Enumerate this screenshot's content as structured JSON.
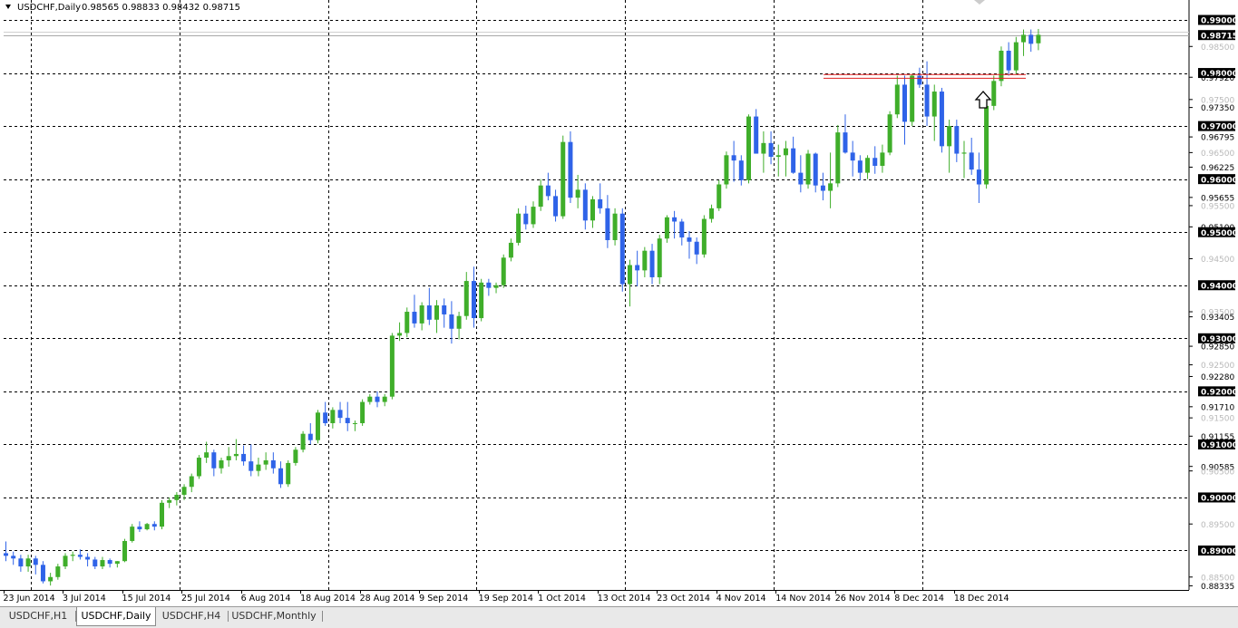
{
  "header": {
    "symbol_label": "USDCHF,Daily",
    "ohlc_text": "0.98565 0.98833 0.98432 0.98715"
  },
  "tabs": [
    {
      "label": "USDCHF,H1",
      "active": false
    },
    {
      "label": "USDCHF,Daily",
      "active": true
    },
    {
      "label": "USDCHF,H4",
      "active": false
    },
    {
      "label": "USDCHF,Monthly",
      "active": false
    }
  ],
  "colors": {
    "bull": "#3fae2a",
    "bear": "#2f63e8",
    "grid": "#000000",
    "resistance": "#e02020",
    "current_price_box": "#000000",
    "current_price_line": "#a8a8a8"
  },
  "chart_data": {
    "type": "candlestick",
    "title": "USDCHF,Daily",
    "ylim": [
      0.88335,
      0.90385
    ],
    "y_axis_labels": [
      {
        "value": 0.99,
        "label": "0.99000",
        "boxed": true
      },
      {
        "value": 0.98715,
        "label": "0.98715",
        "boxed": true,
        "current": true
      },
      {
        "value": 0.985,
        "label": "0.98500",
        "boxed": false,
        "faint": true
      },
      {
        "value": 0.98,
        "label": "0.98000",
        "boxed": true
      },
      {
        "value": 0.9792,
        "label": "0.97920",
        "boxed": false
      },
      {
        "value": 0.975,
        "label": "0.97500",
        "boxed": false,
        "faint": true
      },
      {
        "value": 0.9735,
        "label": "0.97350",
        "boxed": false
      },
      {
        "value": 0.97,
        "label": "0.97000",
        "boxed": true
      },
      {
        "value": 0.96795,
        "label": "0.96795",
        "boxed": false
      },
      {
        "value": 0.965,
        "label": "0.96500",
        "boxed": false,
        "faint": true
      },
      {
        "value": 0.96225,
        "label": "0.96225",
        "boxed": false
      },
      {
        "value": 0.96,
        "label": "0.96000",
        "boxed": true
      },
      {
        "value": 0.95655,
        "label": "0.95655",
        "boxed": false
      },
      {
        "value": 0.955,
        "label": "0.95500",
        "boxed": false,
        "faint": true
      },
      {
        "value": 0.951,
        "label": "0.95100",
        "boxed": false
      },
      {
        "value": 0.95,
        "label": "0.95000",
        "boxed": true
      },
      {
        "value": 0.945,
        "label": "0.94500",
        "boxed": false,
        "faint": true
      },
      {
        "value": 0.94,
        "label": "0.94000",
        "boxed": true
      },
      {
        "value": 0.935,
        "label": "0.93500",
        "boxed": false,
        "faint": true
      },
      {
        "value": 0.93405,
        "label": "0.93405",
        "boxed": false
      },
      {
        "value": 0.93,
        "label": "0.93000",
        "boxed": true
      },
      {
        "value": 0.9285,
        "label": "0.92850",
        "boxed": false
      },
      {
        "value": 0.925,
        "label": "0.92500",
        "boxed": false,
        "faint": true
      },
      {
        "value": 0.9228,
        "label": "0.92280",
        "boxed": false
      },
      {
        "value": 0.92,
        "label": "0.92000",
        "boxed": true
      },
      {
        "value": 0.9171,
        "label": "0.91710",
        "boxed": false
      },
      {
        "value": 0.915,
        "label": "0.91500",
        "boxed": false,
        "faint": true
      },
      {
        "value": 0.91155,
        "label": "0.91155",
        "boxed": false
      },
      {
        "value": 0.91,
        "label": "0.91000",
        "boxed": true
      },
      {
        "value": 0.90585,
        "label": "0.90585",
        "boxed": false
      },
      {
        "value": 0.905,
        "label": "0.90500",
        "boxed": false,
        "faint": true
      },
      {
        "value": 0.9,
        "label": "0.90000",
        "boxed": true
      },
      {
        "value": 0.895,
        "label": "0.89500",
        "boxed": false,
        "faint": true
      },
      {
        "value": 0.89,
        "label": "0.89000",
        "boxed": true
      },
      {
        "value": 0.885,
        "label": "0.88500",
        "boxed": false,
        "faint": true
      },
      {
        "value": 0.88335,
        "label": "0.88335",
        "boxed": false
      }
    ],
    "x_axis_labels": [
      {
        "bar": 0,
        "label": "23 Jun 2014"
      },
      {
        "bar": 8,
        "label": "3 Jul 2014"
      },
      {
        "bar": 16,
        "label": "15 Jul 2014"
      },
      {
        "bar": 24,
        "label": "25 Jul 2014"
      },
      {
        "bar": 32,
        "label": "6 Aug 2014"
      },
      {
        "bar": 40,
        "label": "18 Aug 2014"
      },
      {
        "bar": 48,
        "label": "28 Aug 2014"
      },
      {
        "bar": 56,
        "label": "9 Sep 2014"
      },
      {
        "bar": 64,
        "label": "19 Sep 2014"
      },
      {
        "bar": 72,
        "label": "1 Oct 2014"
      },
      {
        "bar": 80,
        "label": "13 Oct 2014"
      },
      {
        "bar": 88,
        "label": "23 Oct 2014"
      },
      {
        "bar": 96,
        "label": "4 Nov 2014"
      },
      {
        "bar": 104,
        "label": "14 Nov 2014"
      },
      {
        "bar": 112,
        "label": "26 Nov 2014"
      },
      {
        "bar": 120,
        "label": "8 Dec 2014"
      },
      {
        "bar": 128,
        "label": "18 Dec 2014"
      }
    ],
    "horizontal_grid": [
      0.99,
      0.98,
      0.97,
      0.96,
      0.95,
      0.94,
      0.93,
      0.92,
      0.91,
      0.9,
      0.89
    ],
    "current_price": 0.98715,
    "resistance_lines": [
      0.9797,
      0.979
    ],
    "arrow_annotation": "up-arrow",
    "candles": [
      [
        0.8895,
        0.8917,
        0.888,
        0.889
      ],
      [
        0.889,
        0.8898,
        0.8873,
        0.8885
      ],
      [
        0.8885,
        0.8892,
        0.886,
        0.887
      ],
      [
        0.887,
        0.8892,
        0.886,
        0.8885
      ],
      [
        0.8885,
        0.889,
        0.8855,
        0.8873
      ],
      [
        0.8873,
        0.888,
        0.8838,
        0.8842
      ],
      [
        0.8842,
        0.8858,
        0.8834,
        0.885
      ],
      [
        0.885,
        0.8875,
        0.8845,
        0.887
      ],
      [
        0.887,
        0.8895,
        0.8865,
        0.889
      ],
      [
        0.889,
        0.8898,
        0.888,
        0.8892
      ],
      [
        0.8892,
        0.8902,
        0.8883,
        0.8888
      ],
      [
        0.8888,
        0.8895,
        0.887,
        0.8883
      ],
      [
        0.8883,
        0.8888,
        0.8865,
        0.887
      ],
      [
        0.887,
        0.8888,
        0.8865,
        0.8882
      ],
      [
        0.8882,
        0.8885,
        0.8868,
        0.8875
      ],
      [
        0.8875,
        0.888,
        0.8868,
        0.888
      ],
      [
        0.888,
        0.8922,
        0.8878,
        0.8918
      ],
      [
        0.8918,
        0.895,
        0.8915,
        0.8945
      ],
      [
        0.8945,
        0.8955,
        0.8935,
        0.894
      ],
      [
        0.894,
        0.8952,
        0.8938,
        0.895
      ],
      [
        0.895,
        0.8955,
        0.8938,
        0.8945
      ],
      [
        0.8945,
        0.8995,
        0.894,
        0.899
      ],
      [
        0.899,
        0.9,
        0.898,
        0.8995
      ],
      [
        0.8995,
        0.901,
        0.8985,
        0.9005
      ],
      [
        0.9005,
        0.9025,
        0.8995,
        0.902
      ],
      [
        0.902,
        0.9045,
        0.901,
        0.904
      ],
      [
        0.904,
        0.908,
        0.9035,
        0.9075
      ],
      [
        0.9075,
        0.9105,
        0.9065,
        0.9085
      ],
      [
        0.9085,
        0.909,
        0.904,
        0.9055
      ],
      [
        0.9055,
        0.9075,
        0.9045,
        0.907
      ],
      [
        0.907,
        0.9095,
        0.9058,
        0.9078
      ],
      [
        0.9078,
        0.911,
        0.907,
        0.9082
      ],
      [
        0.9082,
        0.9098,
        0.906,
        0.9068
      ],
      [
        0.9068,
        0.91,
        0.904,
        0.905
      ],
      [
        0.905,
        0.9075,
        0.904,
        0.9062
      ],
      [
        0.9062,
        0.9085,
        0.9052,
        0.907
      ],
      [
        0.907,
        0.9085,
        0.9045,
        0.9055
      ],
      [
        0.9055,
        0.9068,
        0.9018,
        0.9025
      ],
      [
        0.9025,
        0.907,
        0.902,
        0.9065
      ],
      [
        0.9065,
        0.9095,
        0.906,
        0.909
      ],
      [
        0.909,
        0.9125,
        0.9085,
        0.912
      ],
      [
        0.912,
        0.914,
        0.91,
        0.9108
      ],
      [
        0.9108,
        0.9165,
        0.9102,
        0.916
      ],
      [
        0.916,
        0.918,
        0.9135,
        0.914
      ],
      [
        0.914,
        0.917,
        0.913,
        0.9165
      ],
      [
        0.9165,
        0.918,
        0.914,
        0.915
      ],
      [
        0.915,
        0.918,
        0.9125,
        0.914
      ],
      [
        0.914,
        0.9145,
        0.9125,
        0.914
      ],
      [
        0.914,
        0.9185,
        0.9135,
        0.918
      ],
      [
        0.918,
        0.9195,
        0.9175,
        0.919
      ],
      [
        0.919,
        0.92,
        0.917,
        0.918
      ],
      [
        0.918,
        0.9195,
        0.9172,
        0.919
      ],
      [
        0.919,
        0.931,
        0.9185,
        0.9305
      ],
      [
        0.9305,
        0.933,
        0.9295,
        0.931
      ],
      [
        0.931,
        0.9358,
        0.9302,
        0.935
      ],
      [
        0.935,
        0.9382,
        0.932,
        0.9328
      ],
      [
        0.9328,
        0.9368,
        0.9315,
        0.9362
      ],
      [
        0.9362,
        0.9395,
        0.9325,
        0.9335
      ],
      [
        0.9335,
        0.9372,
        0.931,
        0.9362
      ],
      [
        0.9362,
        0.9375,
        0.932,
        0.9345
      ],
      [
        0.9345,
        0.937,
        0.929,
        0.9318
      ],
      [
        0.9318,
        0.935,
        0.9298,
        0.9342
      ],
      [
        0.9342,
        0.9425,
        0.9335,
        0.9408
      ],
      [
        0.9408,
        0.9435,
        0.932,
        0.9338
      ],
      [
        0.9338,
        0.9412,
        0.9332,
        0.9405
      ],
      [
        0.9405,
        0.9412,
        0.938,
        0.9395
      ],
      [
        0.9395,
        0.9405,
        0.9385,
        0.94
      ],
      [
        0.94,
        0.9458,
        0.9395,
        0.9452
      ],
      [
        0.9452,
        0.9488,
        0.9445,
        0.948
      ],
      [
        0.948,
        0.9545,
        0.9475,
        0.9535
      ],
      [
        0.9535,
        0.955,
        0.9505,
        0.9515
      ],
      [
        0.9515,
        0.9558,
        0.9508,
        0.9548
      ],
      [
        0.9548,
        0.96,
        0.954,
        0.9588
      ],
      [
        0.9588,
        0.9612,
        0.956,
        0.9568
      ],
      [
        0.9568,
        0.958,
        0.952,
        0.953
      ],
      [
        0.953,
        0.9682,
        0.9525,
        0.967
      ],
      [
        0.967,
        0.969,
        0.9555,
        0.9565
      ],
      [
        0.9565,
        0.9608,
        0.9545,
        0.958
      ],
      [
        0.958,
        0.9592,
        0.9505,
        0.9522
      ],
      [
        0.9522,
        0.9568,
        0.9508,
        0.9562
      ],
      [
        0.9562,
        0.9592,
        0.9535,
        0.9545
      ],
      [
        0.9545,
        0.957,
        0.947,
        0.9485
      ],
      [
        0.9485,
        0.9545,
        0.9475,
        0.9535
      ],
      [
        0.9535,
        0.9545,
        0.9388,
        0.9402
      ],
      [
        0.9402,
        0.9448,
        0.936,
        0.9438
      ],
      [
        0.9438,
        0.9465,
        0.9398,
        0.9428
      ],
      [
        0.9428,
        0.9472,
        0.9415,
        0.9465
      ],
      [
        0.9465,
        0.9478,
        0.9402,
        0.9415
      ],
      [
        0.9415,
        0.9495,
        0.9402,
        0.9488
      ],
      [
        0.9488,
        0.9532,
        0.948,
        0.9528
      ],
      [
        0.9528,
        0.954,
        0.9488,
        0.952
      ],
      [
        0.952,
        0.9525,
        0.9475,
        0.949
      ],
      [
        0.949,
        0.9502,
        0.945,
        0.9482
      ],
      [
        0.9482,
        0.949,
        0.944,
        0.9458
      ],
      [
        0.9458,
        0.9532,
        0.9452,
        0.9525
      ],
      [
        0.9525,
        0.9552,
        0.9518,
        0.9545
      ],
      [
        0.9545,
        0.9598,
        0.954,
        0.959
      ],
      [
        0.959,
        0.9652,
        0.9582,
        0.9645
      ],
      [
        0.9645,
        0.9672,
        0.9595,
        0.9635
      ],
      [
        0.9635,
        0.9645,
        0.9588,
        0.9598
      ],
      [
        0.9598,
        0.9722,
        0.9592,
        0.9718
      ],
      [
        0.9718,
        0.9732,
        0.9648,
        0.9648
      ],
      [
        0.9648,
        0.969,
        0.9612,
        0.9668
      ],
      [
        0.9668,
        0.969,
        0.9628,
        0.9642
      ],
      [
        0.9642,
        0.9665,
        0.9605,
        0.9645
      ],
      [
        0.9645,
        0.9672,
        0.9605,
        0.9658
      ],
      [
        0.9658,
        0.968,
        0.961,
        0.9612
      ],
      [
        0.9612,
        0.9645,
        0.9575,
        0.959
      ],
      [
        0.959,
        0.9655,
        0.9582,
        0.9648
      ],
      [
        0.9648,
        0.965,
        0.9575,
        0.9588
      ],
      [
        0.9588,
        0.9612,
        0.956,
        0.9578
      ],
      [
        0.9578,
        0.965,
        0.9545,
        0.9592
      ],
      [
        0.9592,
        0.9702,
        0.9585,
        0.9688
      ],
      [
        0.9688,
        0.9722,
        0.9648,
        0.965
      ],
      [
        0.965,
        0.9672,
        0.9605,
        0.9635
      ],
      [
        0.9635,
        0.9645,
        0.9598,
        0.9612
      ],
      [
        0.9612,
        0.9645,
        0.96,
        0.964
      ],
      [
        0.964,
        0.9662,
        0.961,
        0.9625
      ],
      [
        0.9625,
        0.9665,
        0.9612,
        0.965
      ],
      [
        0.965,
        0.9728,
        0.9645,
        0.9722
      ],
      [
        0.9722,
        0.9795,
        0.9715,
        0.9778
      ],
      [
        0.9778,
        0.9795,
        0.9665,
        0.9708
      ],
      [
        0.9708,
        0.9798,
        0.97,
        0.9795
      ],
      [
        0.9795,
        0.981,
        0.9772,
        0.9778
      ],
      [
        0.9778,
        0.9822,
        0.97,
        0.9718
      ],
      [
        0.9718,
        0.9778,
        0.9672,
        0.9765
      ],
      [
        0.9765,
        0.9772,
        0.965,
        0.9662
      ],
      [
        0.9662,
        0.9712,
        0.9612,
        0.97
      ],
      [
        0.97,
        0.9712,
        0.9632,
        0.9648
      ],
      [
        0.9648,
        0.9672,
        0.9602,
        0.965
      ],
      [
        0.965,
        0.9678,
        0.9608,
        0.9618
      ],
      [
        0.9618,
        0.965,
        0.9555,
        0.959
      ],
      [
        0.959,
        0.9758,
        0.9582,
        0.9738
      ],
      [
        0.9738,
        0.9795,
        0.973,
        0.9785
      ],
      [
        0.9785,
        0.985,
        0.9775,
        0.9842
      ],
      [
        0.9842,
        0.9858,
        0.9795,
        0.9805
      ],
      [
        0.9805,
        0.9868,
        0.9798,
        0.9858
      ],
      [
        0.9858,
        0.9882,
        0.9832,
        0.9872
      ],
      [
        0.9872,
        0.9882,
        0.984,
        0.9855
      ],
      [
        0.9856,
        0.9883,
        0.9843,
        0.9872
      ]
    ]
  }
}
